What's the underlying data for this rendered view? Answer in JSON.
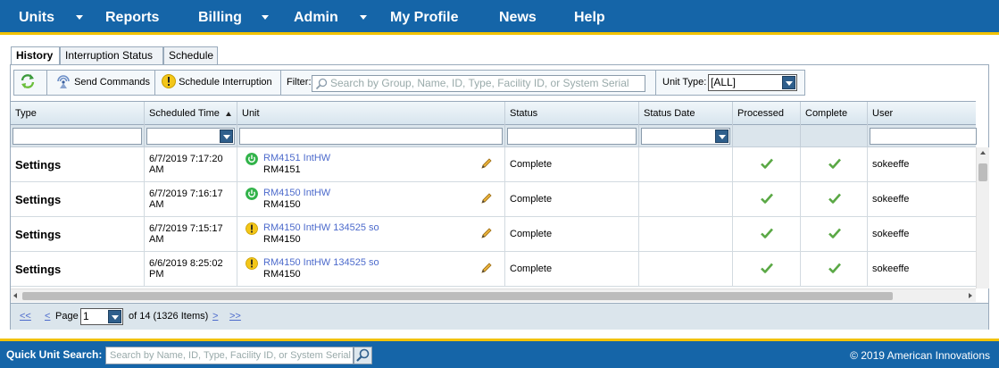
{
  "nav": {
    "items": [
      {
        "label": "Units",
        "has_menu": true
      },
      {
        "label": "Reports",
        "has_menu": false
      },
      {
        "label": "Billing",
        "has_menu": true
      },
      {
        "label": "Admin",
        "has_menu": true
      },
      {
        "label": "My Profile",
        "has_menu": false
      },
      {
        "label": "News",
        "has_menu": false
      },
      {
        "label": "Help",
        "has_menu": false
      }
    ]
  },
  "tabs": [
    {
      "label": "History",
      "active": true
    },
    {
      "label": "Interruption Status",
      "active": false
    },
    {
      "label": "Schedule",
      "active": false
    }
  ],
  "toolbar": {
    "refresh_icon": "refresh-icon",
    "send_commands_label": "Send Commands",
    "schedule_interruption_label": "Schedule Interruption",
    "filter_label": "Filter:",
    "filter_placeholder": "Search by Group, Name, ID, Type, Facility ID, or System Serial",
    "unit_type_label": "Unit Type:",
    "unit_type_value": "[ALL]"
  },
  "grid": {
    "columns": [
      "Type",
      "Scheduled Time",
      "Unit",
      "Status",
      "Status Date",
      "Processed",
      "Complete",
      "User"
    ],
    "sort_column": "Scheduled Time",
    "sort_direction": "ascending",
    "rows": [
      {
        "type": "Settings",
        "scheduled_line1": "6/7/2019 7:17:20",
        "scheduled_line2": "AM",
        "unit_status": "power",
        "unit_link": "RM4151 IntHW",
        "unit_sub": "RM4151",
        "status": "Complete",
        "status_date": "",
        "processed": true,
        "complete": true,
        "user": "sokeeffe"
      },
      {
        "type": "Settings",
        "scheduled_line1": "6/7/2019 7:16:17",
        "scheduled_line2": "AM",
        "unit_status": "power",
        "unit_link": "RM4150 IntHW",
        "unit_sub": "RM4150",
        "status": "Complete",
        "status_date": "",
        "processed": true,
        "complete": true,
        "user": "sokeeffe"
      },
      {
        "type": "Settings",
        "scheduled_line1": "6/7/2019 7:15:17",
        "scheduled_line2": "AM",
        "unit_status": "warning",
        "unit_link": "RM4150 IntHW 134525 so",
        "unit_sub": "RM4150",
        "status": "Complete",
        "status_date": "",
        "processed": true,
        "complete": true,
        "user": "sokeeffe"
      },
      {
        "type": "Settings",
        "scheduled_line1": "6/6/2019 8:25:02",
        "scheduled_line2": "PM",
        "unit_status": "warning",
        "unit_link": "RM4150 IntHW 134525 so",
        "unit_sub": "RM4150",
        "status": "Complete",
        "status_date": "",
        "processed": true,
        "complete": true,
        "user": "sokeeffe"
      }
    ]
  },
  "pager": {
    "first": "<<",
    "prev": "<",
    "page_label": "Page",
    "page_value": "1",
    "of_text": "of 14 (1326 Items)",
    "next": ">",
    "last": ">>"
  },
  "footer": {
    "quick_search_label": "Quick Unit Search:",
    "quick_search_placeholder": "Search by Name, ID, Type, Facility ID, or System Serial",
    "copyright": "© 2019 American Innovations"
  },
  "colors": {
    "nav_bg": "#1565a8",
    "accent_yellow": "#f2c200",
    "link": "#4d6bcc",
    "check_green": "#5aa845"
  }
}
